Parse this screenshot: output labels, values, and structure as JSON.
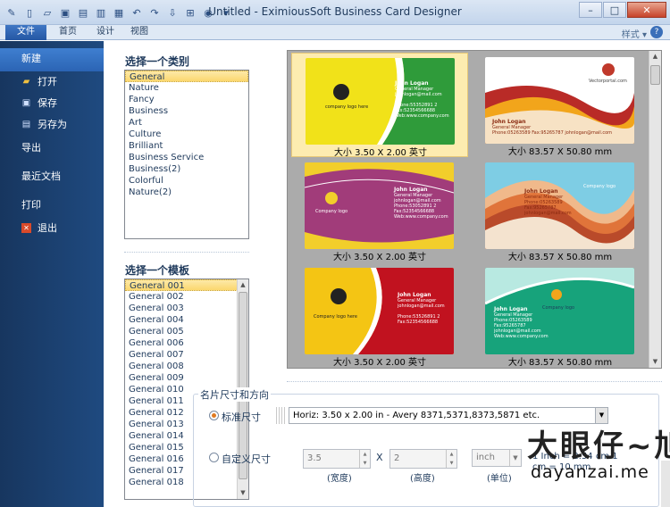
{
  "window": {
    "title": "Untitled - EximiousSoft Business Card Designer",
    "minimize": "–",
    "maximize": "□",
    "close": "✕"
  },
  "quick_access": [
    "app-icon",
    "new-icon",
    "open-icon",
    "save-icon",
    "pdf-icon",
    "print-icon",
    "image-icon",
    "undo-icon",
    "redo-icon",
    "export-icon",
    "cart-icon",
    "help-icon",
    "dropdown-icon"
  ],
  "ribbon": {
    "tabs": {
      "file": "文件",
      "home": "首页",
      "design": "设计",
      "view": "视图"
    },
    "style_menu": "样式 ▾",
    "help": "?"
  },
  "nav": {
    "new": "新建",
    "open": "打开",
    "save": "保存",
    "save_as": "另存为",
    "export": "导出",
    "recent": "最近文档",
    "print": "打印",
    "exit": "退出"
  },
  "categories": {
    "heading": "选择一个类别",
    "items": [
      "General",
      "Nature",
      "Fancy",
      "Business",
      "Art",
      "Culture",
      "Brilliant",
      "Business Service",
      "Business(2)",
      "Colorful",
      "Nature(2)"
    ],
    "selected": "General"
  },
  "templates": {
    "heading": "选择一个模板",
    "items": [
      "General 001",
      "General 002",
      "General 003",
      "General 004",
      "General 005",
      "General 006",
      "General 007",
      "General 008",
      "General 009",
      "General 010",
      "General 011",
      "General 012",
      "General 013",
      "General 014",
      "General 015",
      "General 016",
      "General 017",
      "General 018"
    ],
    "selected": "General 001"
  },
  "gallery": {
    "cards": [
      {
        "caption": "大小 3.50 X 2.00 英寸",
        "logo": "company logo here",
        "name": "John Logan",
        "title": "General Manager",
        "lines": [
          "johnlogan@mail.com",
          "",
          "Phone:55352891 2",
          "Fax:52354566688",
          "Web:www.company.com"
        ]
      },
      {
        "caption": "大小 83.57 X 50.80 mm",
        "logo": "Vectorportal.com",
        "name": "John Logan",
        "title": "General Manager",
        "lines": [
          "Phone:05263589  Fax:95265787  johnlogan@mail.com"
        ]
      },
      {
        "caption": "大小 3.50 X 2.00 英寸",
        "logo": "Company logo",
        "name": "John Logan",
        "title": "General Manager",
        "lines": [
          "johnlogan@mail.com",
          "Phone:53052891 2",
          "Fax:52354566688",
          "Web:www.company.com"
        ]
      },
      {
        "caption": "大小 83.57 X 50.80 mm",
        "logo": "Company logo",
        "name": "John Logan",
        "title": "General Manager",
        "lines": [
          "Phone:05263589",
          "Fax:95265787",
          "johnlogan@mail.com"
        ]
      },
      {
        "caption": "大小 3.50 X 2.00 英寸",
        "logo": "Company logo here",
        "name": "John Logan",
        "title": "General Manager",
        "lines": [
          "johnlogan@mail.com",
          "",
          "Phone:53526891 2",
          "Fax:52354566688"
        ]
      },
      {
        "caption": "大小 83.57 X 50.80 mm",
        "logo": "Company logo",
        "name": "John Logan",
        "title": "General Manager",
        "lines": [
          "Phone:05263589",
          "Fax:95265787",
          "johnlogan@mail.com",
          "Web:www.company.com"
        ]
      }
    ]
  },
  "size_options": {
    "group_title": "名片尺寸和方向",
    "standard_label": "标准尺寸",
    "standard_selected": true,
    "standard_value": "Horiz: 3.50 x 2.00 in - Avery 8371,5371,8373,5871 etc.",
    "custom_label": "自定义尺寸",
    "width_value": "3.5",
    "x_mark": "X",
    "height_value": "2",
    "unit_value": "inch",
    "width_label": "(宽度)",
    "height_label": "(高度)",
    "unit_label": "(单位)",
    "conversion": "1 Inch = 2.54 cm  1 cm = 10 mm"
  },
  "watermark": {
    "cn": "大眼仔~旭",
    "en": "dayanzai.me"
  },
  "colors": {
    "nav_bg": "#1f4a80",
    "nav_selected": "#3f7fd0",
    "selection": "#fbd76e",
    "accent_radio": "#e07b22"
  }
}
